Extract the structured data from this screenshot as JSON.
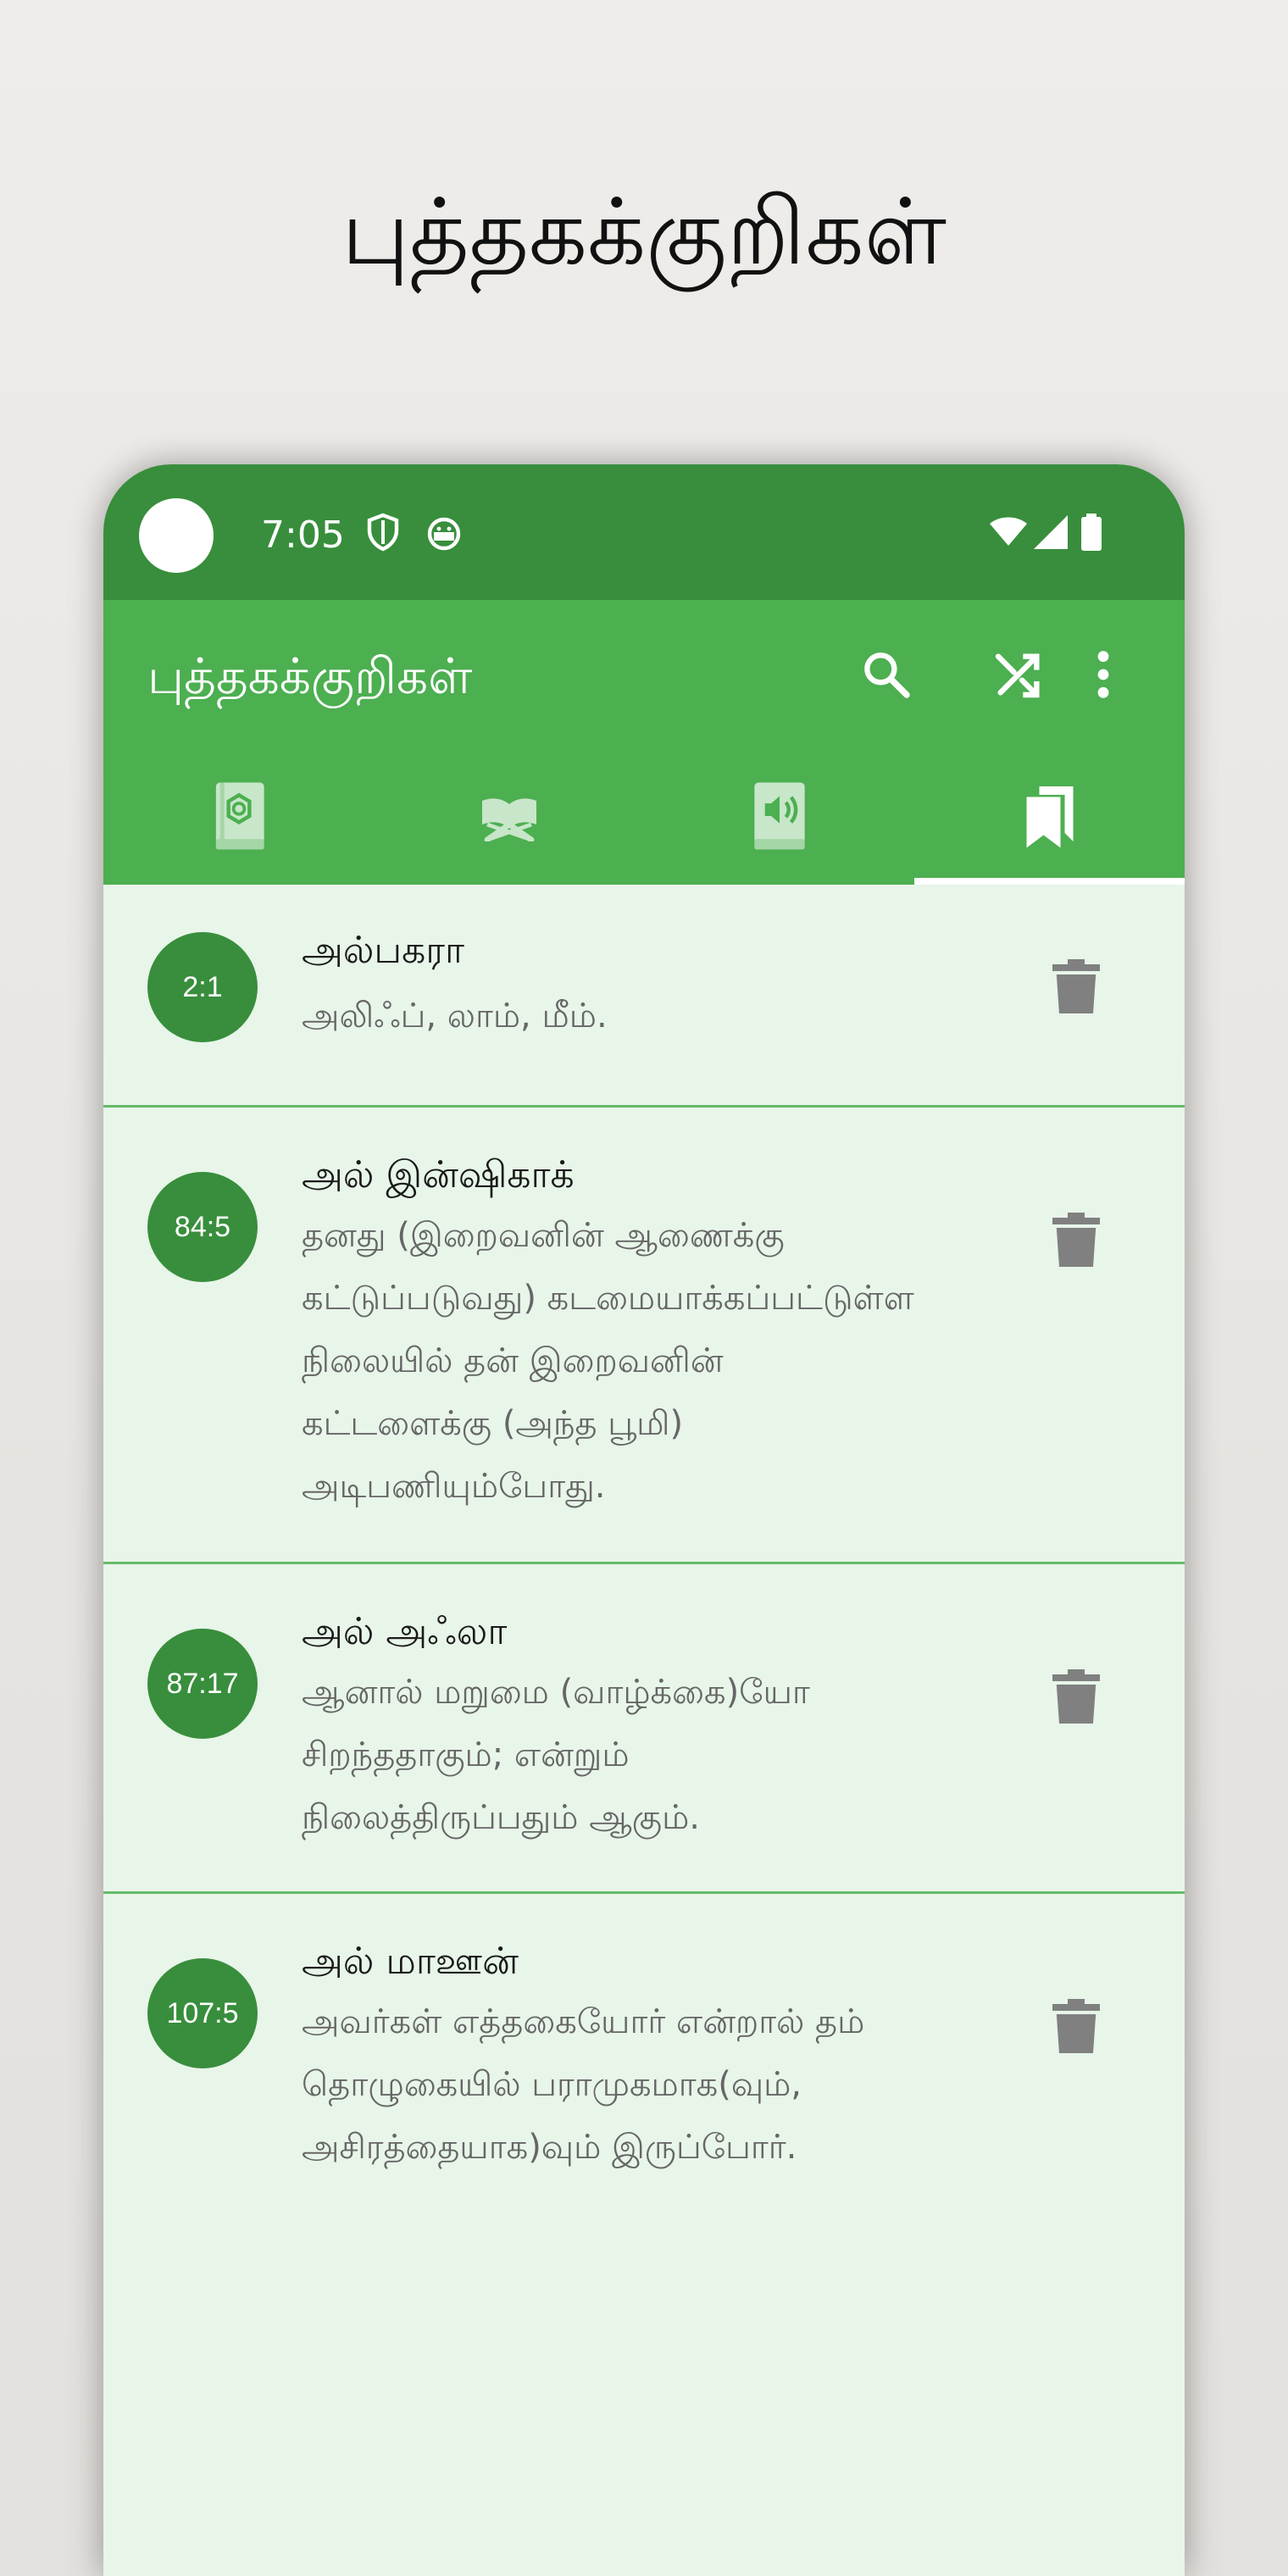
{
  "headline": "புத்தகக்குறிகள்",
  "status_bar": {
    "time": "7:05",
    "icons": [
      "shield-icon",
      "android-face-icon",
      "wifi-icon",
      "signal-icon",
      "battery-icon"
    ]
  },
  "app_bar": {
    "title": "புத்தகக்குறிகள்",
    "actions": [
      "search-icon",
      "shuffle-icon",
      "more-vert-icon"
    ]
  },
  "tabs": [
    {
      "icon": "quran-book-icon",
      "active": false
    },
    {
      "icon": "open-book-icon",
      "active": false
    },
    {
      "icon": "audio-book-icon",
      "active": false
    },
    {
      "icon": "bookmarks-icon",
      "active": true
    }
  ],
  "colors": {
    "status_bar": "#388e3c",
    "app_bar": "#4caf50",
    "list_bg": "#e8f5e9",
    "badge": "#388e3c",
    "divider": "#66bb6a",
    "trash": "#808080"
  },
  "bookmarks": [
    {
      "badge": "2:1",
      "title": "அல்பகரா",
      "lines": [
        "அலிஃப், லாம், மீம்."
      ]
    },
    {
      "badge": "84:5",
      "title": "அல் இன்ஷிகாக்",
      "lines": [
        "தனது (இறைவனின் ஆணைக்கு",
        "கட்டுப்படுவது) கடமையாக்கப்பட்டுள்ள",
        "நிலையில் தன் இறைவனின்",
        "கட்டளைக்கு (அந்த பூமி)",
        "அடிபணியும்போது."
      ]
    },
    {
      "badge": "87:17",
      "title": "அல் அஃலா",
      "lines": [
        "ஆனால் மறுமை (வாழ்க்கை)யோ",
        "சிறந்ததாகும்; என்றும்",
        "நிலைத்திருப்பதும் ஆகும்."
      ]
    },
    {
      "badge": "107:5",
      "title": "அல் மாஊன்",
      "lines": [
        "அவர்கள் எத்தகையோர் என்றால் தம்",
        "தொழுகையில் பராமுகமாக(வும்,",
        "அசிரத்தையாக)வும் இருப்போர்."
      ]
    }
  ]
}
